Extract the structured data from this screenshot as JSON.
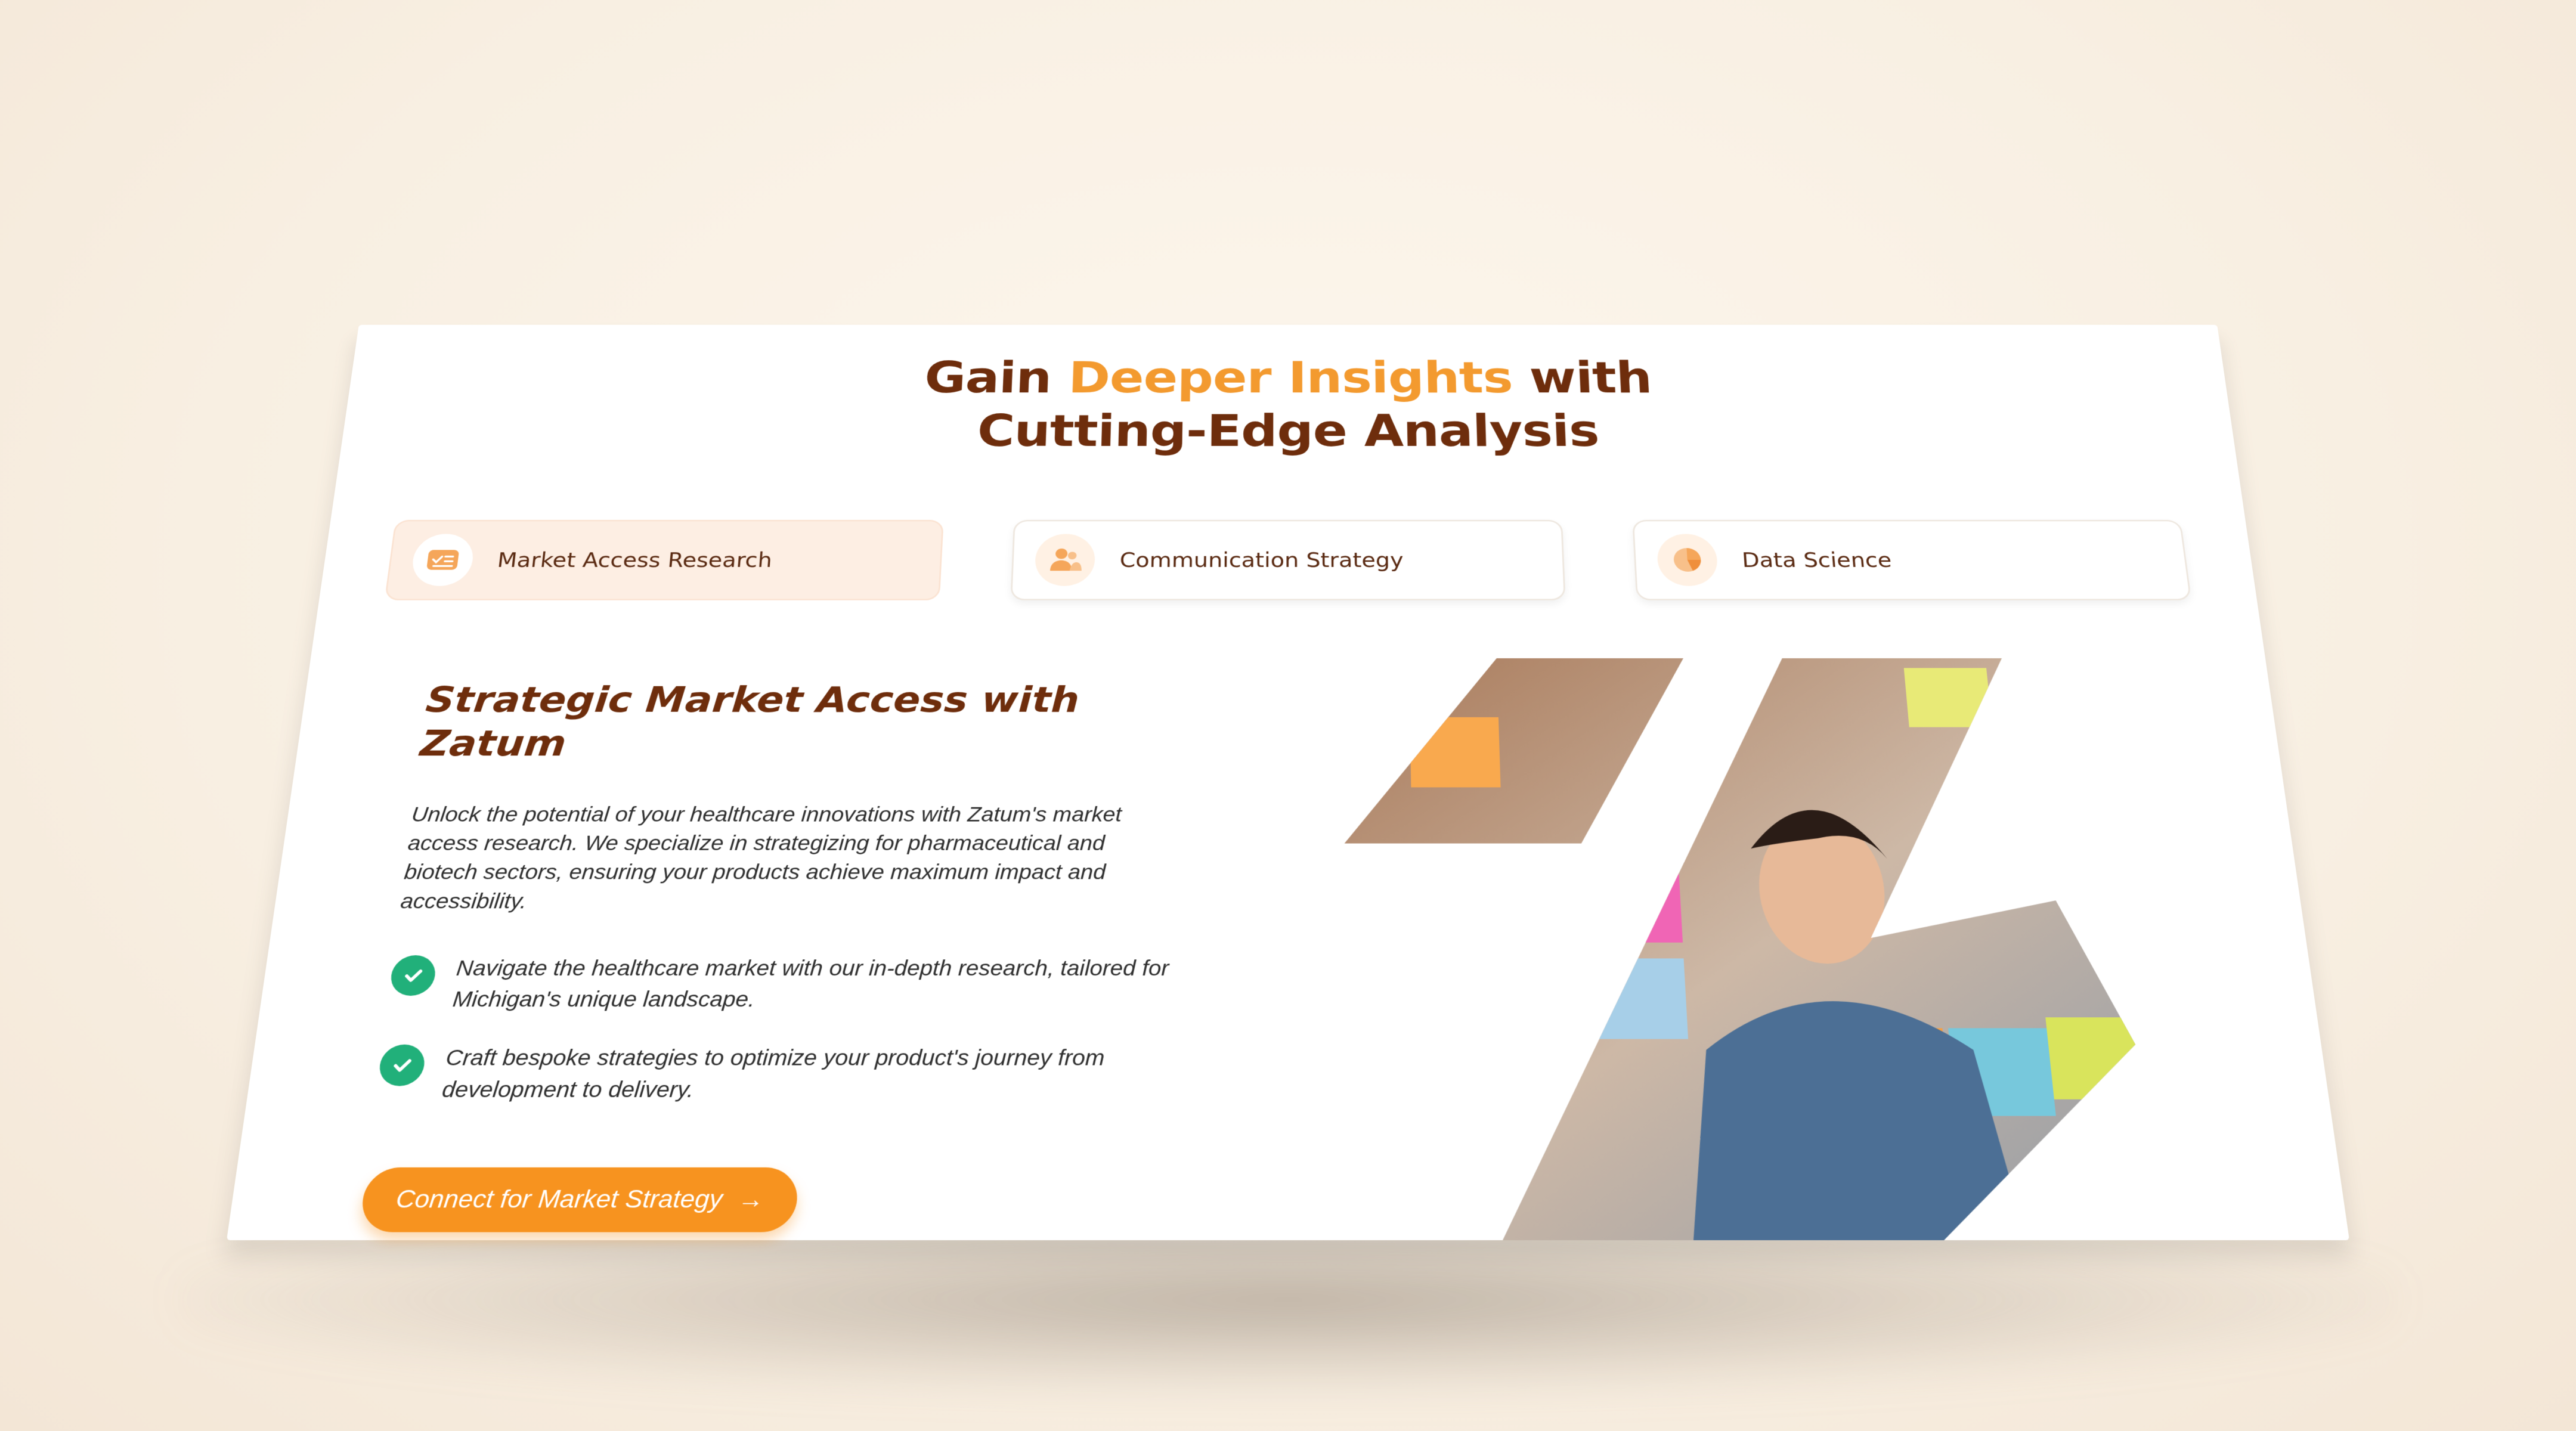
{
  "headline": {
    "part1": "Gain ",
    "accent": "Deeper Insights",
    "part2": " with",
    "line2": "Cutting-Edge Analysis"
  },
  "tabs": [
    {
      "label": "Market Access Research",
      "icon": "checklist-card-icon",
      "active": true
    },
    {
      "label": "Communication Strategy",
      "icon": "users-icon",
      "active": false
    },
    {
      "label": "Data Science",
      "icon": "pie-chart-icon",
      "active": false
    }
  ],
  "content": {
    "title": "Strategic Market Access with Zatum",
    "paragraph": "Unlock the potential of your healthcare innovations with Zatum's market access research. We specialize in strategizing for pharmaceutical and biotech sectors, ensuring your products achieve maximum impact and accessibility.",
    "bullets": [
      "Navigate the healthcare market with our in-depth research, tailored for Michigan's unique landscape.",
      "Craft bespoke strategies to optimize your product's journey from development to delivery."
    ],
    "cta_label": "Connect for Market Strategy"
  },
  "colors": {
    "brand_brown": "#6e2d0c",
    "accent_orange": "#f39a2f",
    "button_orange": "#f7931f",
    "check_green": "#21b07a",
    "active_tab_bg": "#fdeee3"
  }
}
